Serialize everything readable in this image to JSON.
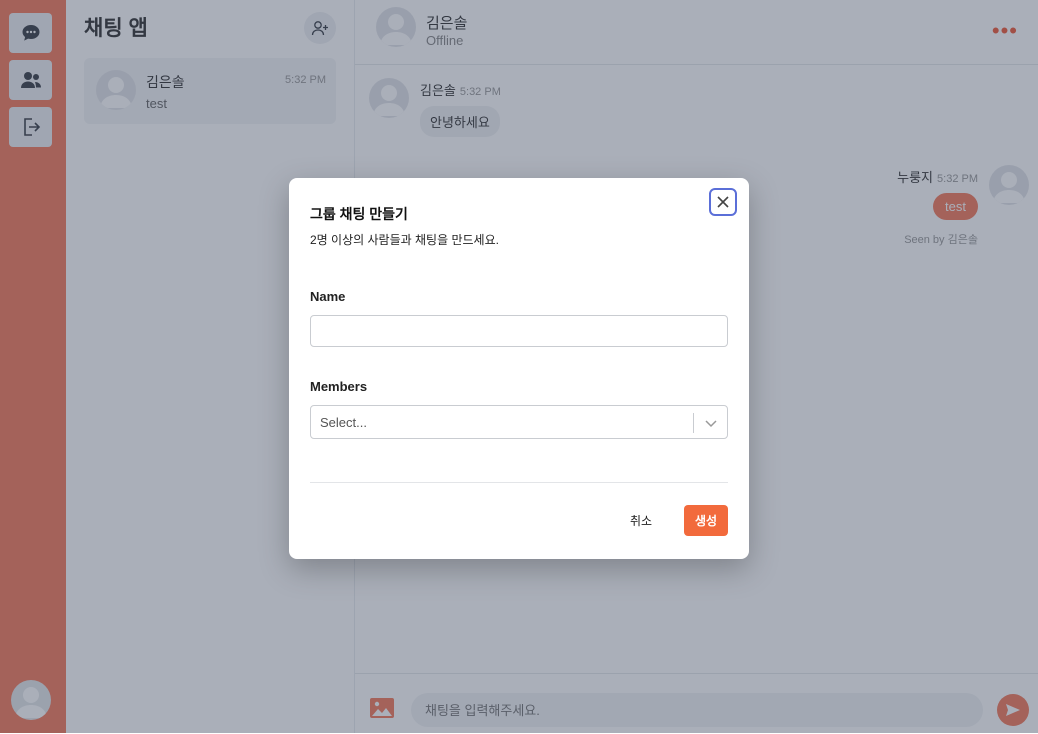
{
  "app": {
    "title": "채팅 앱"
  },
  "rail": {
    "items": [
      {
        "icon": "chat-icon"
      },
      {
        "icon": "users-icon"
      },
      {
        "icon": "logout-icon"
      }
    ]
  },
  "sidebar": {
    "rooms": [
      {
        "name": "김은솔",
        "time": "5:32 PM",
        "last_message": "test"
      }
    ]
  },
  "chat": {
    "header": {
      "name": "김은솔",
      "status": "Offline",
      "more": "•••"
    },
    "messages": [
      {
        "sender": "김은솔",
        "time": "5:32 PM",
        "text": "안녕하세요",
        "direction": "in"
      },
      {
        "sender": "누룽지",
        "time": "5:32 PM",
        "text": "test",
        "direction": "out"
      }
    ],
    "seen_prefix": "Seen by",
    "seen_by": "김은솔",
    "composer": {
      "placeholder": "채팅을 입력해주세요."
    }
  },
  "modal": {
    "title": "그룹 채팅 만들기",
    "description": "2명 이상의 사람들과 채팅을 만드세요.",
    "name_label": "Name",
    "name_value": "",
    "members_label": "Members",
    "members_placeholder": "Select...",
    "cancel_label": "취소",
    "create_label": "생성"
  },
  "colors": {
    "accent": "#f47a5c",
    "create_button": "#f26a3c",
    "focus_ring": "#5b6fd8"
  }
}
